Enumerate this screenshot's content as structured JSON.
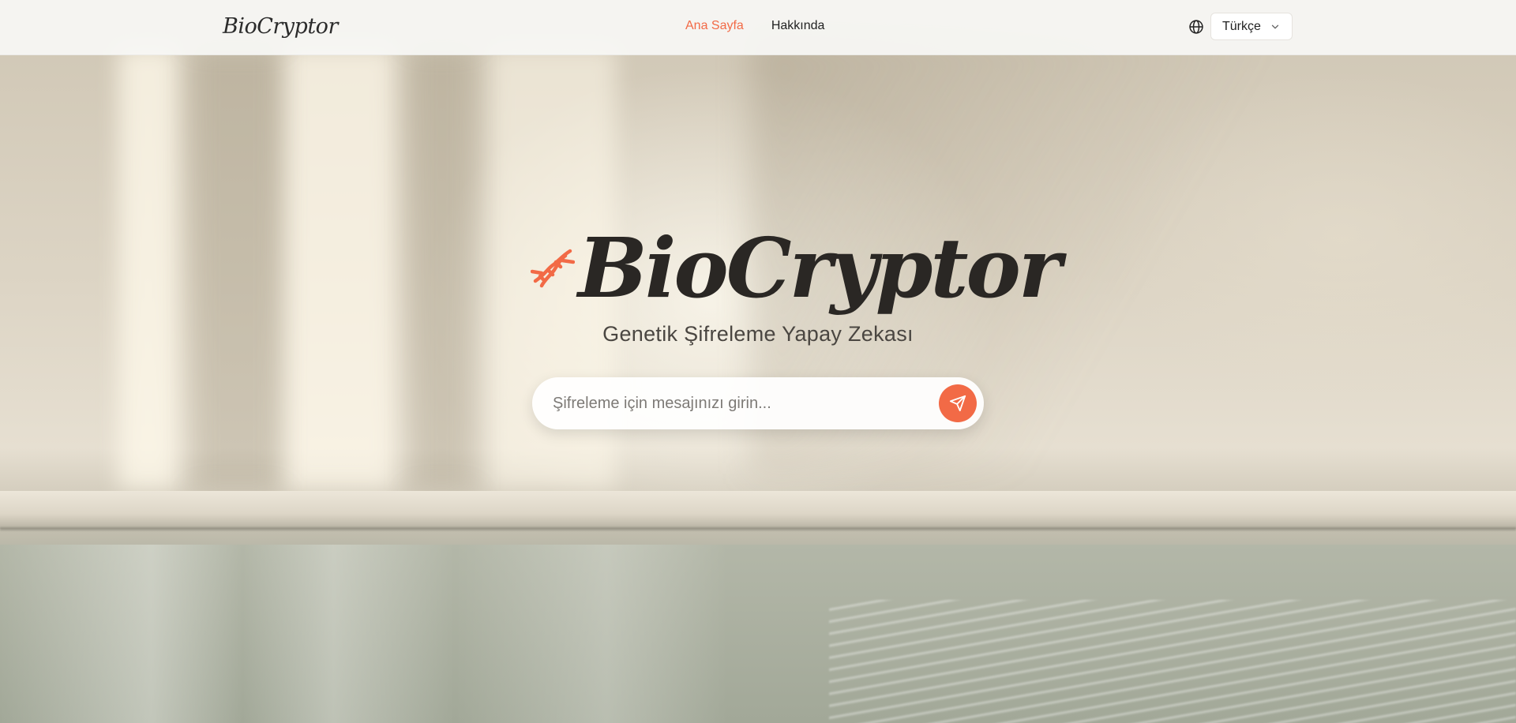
{
  "header": {
    "brand": "BioCryptor",
    "nav": [
      {
        "label": "Ana Sayfa",
        "active": true
      },
      {
        "label": "Hakkında",
        "active": false
      }
    ],
    "language": {
      "icon": "globe-icon",
      "selected": "Türkçe"
    }
  },
  "hero": {
    "icon": "dna-icon",
    "title": "BioCryptor",
    "subtitle": "Genetik Şifreleme Yapay Zekası",
    "search": {
      "placeholder": "Şifreleme için mesajınızı girin...",
      "value": "",
      "send_icon": "send-icon"
    }
  },
  "colors": {
    "accent": "#f26a46",
    "text_dark": "#2a2724",
    "header_bg": "#f8f7f5"
  }
}
